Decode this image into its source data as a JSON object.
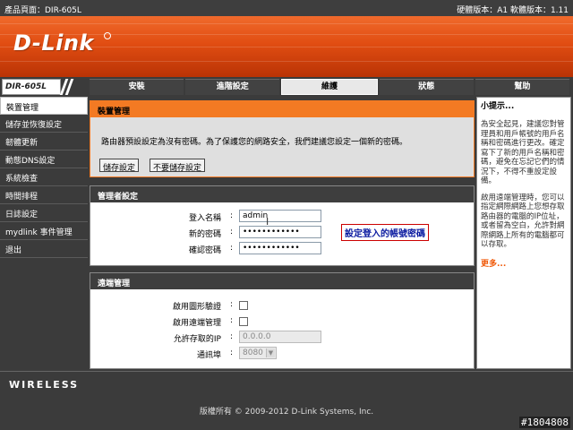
{
  "topbar": {
    "product": "產品頁面：DIR-605L",
    "versions": "硬體版本：A1   軟體版本：1.11"
  },
  "brand": {
    "logo": "D-Link",
    "model": "DIR-605L"
  },
  "tabs": [
    {
      "label": "安裝"
    },
    {
      "label": "進階設定"
    },
    {
      "label": "維護",
      "active": true
    },
    {
      "label": "狀態"
    },
    {
      "label": "幫助"
    }
  ],
  "sidebar": {
    "items": [
      {
        "label": "裝置管理",
        "active": true
      },
      {
        "label": "儲存並恢復設定"
      },
      {
        "label": "韌體更新"
      },
      {
        "label": "動態DNS設定"
      },
      {
        "label": "系統檢查"
      },
      {
        "label": "時間排程"
      },
      {
        "label": "日誌設定"
      },
      {
        "label": "mydlink 事件管理"
      },
      {
        "label": "退出"
      }
    ]
  },
  "device_mgmt": {
    "title": "裝置管理",
    "description": "路由器預設設定為沒有密碼。為了保護您的網路安全，我們建議您設定一個新的密碼。",
    "save_button": "儲存設定",
    "nosave_button": "不要儲存設定"
  },
  "admin": {
    "title": "管理者設定",
    "username_label": "登入名稱",
    "username_value": "admin",
    "password_label": "新的密碼",
    "password_value": "••••••••••••",
    "confirm_label": "確認密碼",
    "confirm_value": "••••••••••••",
    "annotation": "設定登入的帳號密碼"
  },
  "remote": {
    "title": "遠端管理",
    "graphic_auth_label": "啟用圖形驗證",
    "remote_mgmt_label": "啟用遠端管理",
    "allowed_ip_label": "允許存取的IP",
    "allowed_ip_value": "0.0.0.0",
    "port_label": "通訊埠",
    "port_value": "8080"
  },
  "hints": {
    "title": "小提示...",
    "p1": "為安全起見，建議您對管理員和用戶帳號的用戶名稱和密碼進行更改。確定寫下了新的用戶名稱和密碼，避免在忘記它們的情況下，不得不重設定設備。",
    "p2": "啟用遠端管理時，您可以指定網際網路上您想存取路由器的電腦的IP位址，或者留為空白，允許對網際網路上所有的電腦都可以存取。",
    "more": "更多..."
  },
  "footer": {
    "wireless": "WIRELESS",
    "copyright": "版權所有 © 2009-2012 D-Link Systems, Inc.",
    "watermark": "#1804808"
  },
  "colors": {
    "accent": "#f37a23",
    "banner": "#e14d12",
    "dark": "#3b3b3b"
  }
}
